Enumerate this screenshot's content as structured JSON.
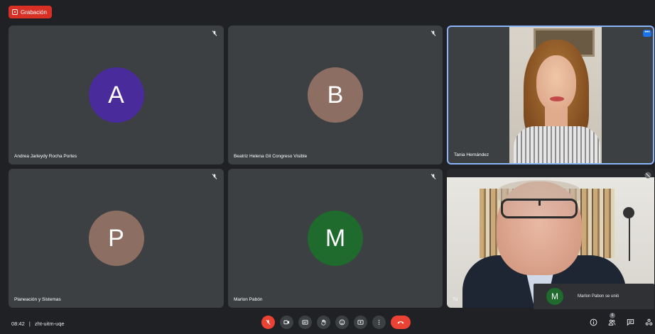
{
  "recording": {
    "label": "Grabación"
  },
  "tiles": [
    {
      "name": "Andrea Jarleydy Rocha Portes",
      "initial": "A",
      "color": "#4a2b9b"
    },
    {
      "name": "Beatriz Helena Gil Congreso Visible",
      "initial": "B",
      "color": "#8d6e63"
    },
    {
      "name": "Tania Hernández",
      "video": true
    },
    {
      "name": "Planeación y Sistemas",
      "initial": "P",
      "color": "#8d6e63"
    },
    {
      "name": "Marlon Pabón",
      "initial": "M",
      "color": "#1e6b2d"
    },
    {
      "name": "Tú",
      "video": true
    }
  ],
  "toast": {
    "initial": "M",
    "text": "Marlon Pabon se unió"
  },
  "meeting": {
    "time": "08:42",
    "separator": "|",
    "code": "zht-uitm-uqe"
  },
  "participants_count": "6",
  "icons": {
    "mic_off": "mic-off-icon",
    "camera": "camera-icon",
    "captions": "captions-icon",
    "hand": "raise-hand-icon",
    "emoji": "emoji-icon",
    "present": "present-icon",
    "more": "more-vert-icon",
    "end": "end-call-icon",
    "info": "info-icon",
    "people": "people-icon",
    "chat": "chat-icon",
    "activities": "activities-icon"
  },
  "colors": {
    "accent": "#8ab4f8",
    "danger": "#ea4335",
    "surface": "#3c4043",
    "background": "#202124"
  }
}
